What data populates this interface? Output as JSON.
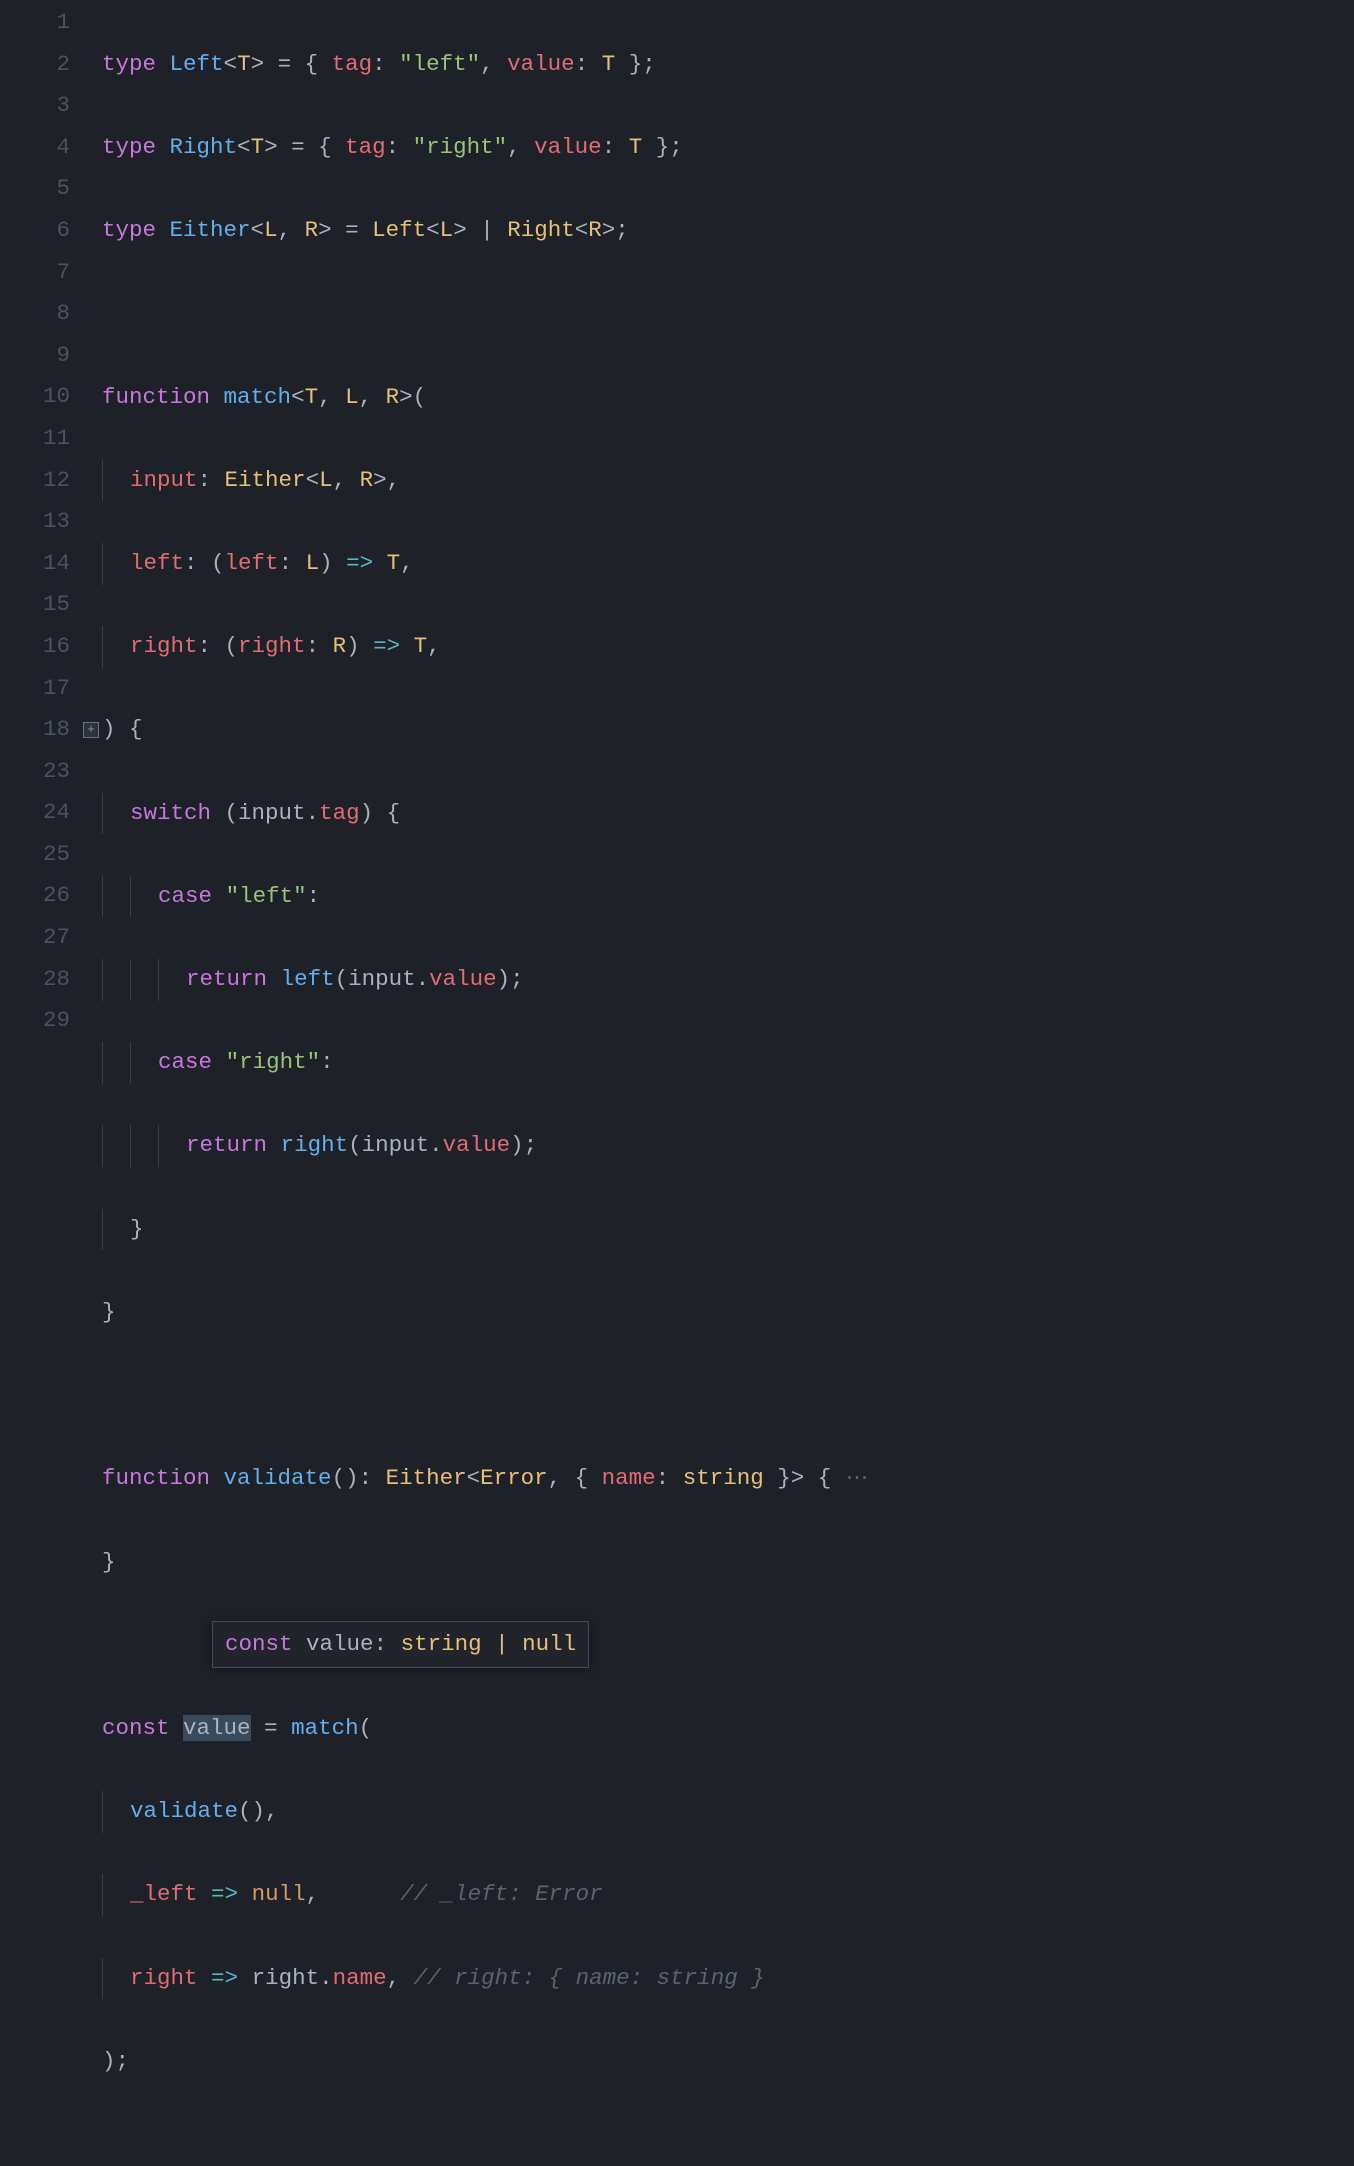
{
  "gutter": {
    "lines": [
      "1",
      "2",
      "3",
      "4",
      "5",
      "6",
      "7",
      "8",
      "9",
      "10",
      "11",
      "12",
      "13",
      "14",
      "15",
      "16",
      "17",
      "18",
      "23",
      "24",
      "25",
      "26",
      "27",
      "28",
      "29"
    ]
  },
  "fold": {
    "plus": "+"
  },
  "hover": {
    "kw": "const",
    "name": "value",
    "type": "string | null"
  },
  "code": {
    "l1": {
      "kw": "type",
      "name": "Left",
      "gen": "T",
      "eq": " = { ",
      "tagk": "tag",
      "tagv": "\"left\"",
      "valk": "value",
      "valg": "T",
      "end": " };"
    },
    "l2": {
      "kw": "type",
      "name": "Right",
      "gen": "T",
      "eq": " = { ",
      "tagk": "tag",
      "tagv": "\"right\"",
      "valk": "value",
      "valg": "T",
      "end": " };"
    },
    "l3": {
      "kw": "type",
      "name": "Either",
      "genL": "L",
      "genR": "R",
      "eq": " = ",
      "left": "Left",
      "right": "Right",
      "end": ";"
    },
    "l5": {
      "kw": "function",
      "name": "match",
      "t": "T",
      "l": "L",
      "r": "R"
    },
    "l6": {
      "p": "input",
      "ty": "Either",
      "l": "L",
      "r": "R"
    },
    "l7": {
      "p": "left",
      "pp": "left",
      "pg": "L",
      "rt": "T"
    },
    "l8": {
      "p": "right",
      "pp": "right",
      "pg": "R",
      "rt": "T"
    },
    "l9": {
      "txt": ") {"
    },
    "l10": {
      "kw": "switch",
      "obj": "input",
      "prop": "tag"
    },
    "l11": {
      "kw": "case",
      "val": "\"left\""
    },
    "l12": {
      "kw": "return",
      "fn": "left",
      "obj": "input",
      "prop": "value"
    },
    "l13": {
      "kw": "case",
      "val": "\"right\""
    },
    "l14": {
      "kw": "return",
      "fn": "right",
      "obj": "input",
      "prop": "value"
    },
    "l15": {
      "txt": "}"
    },
    "l16": {
      "txt": "}"
    },
    "l18": {
      "kw": "function",
      "name": "validate",
      "ret": "Either",
      "err": "Error",
      "nk": "name",
      "nt": "string"
    },
    "l23": {
      "txt": "}"
    },
    "l25": {
      "kw": "const",
      "name": "value",
      "fn": "match"
    },
    "l26": {
      "fn": "validate"
    },
    "l27": {
      "p": "_left",
      "v": "null",
      "c": "// _left: Error"
    },
    "l28": {
      "p": "right",
      "obj": "right",
      "prop": "name",
      "c": "// right: { name: string }"
    },
    "l29": {
      "txt": ");"
    }
  }
}
